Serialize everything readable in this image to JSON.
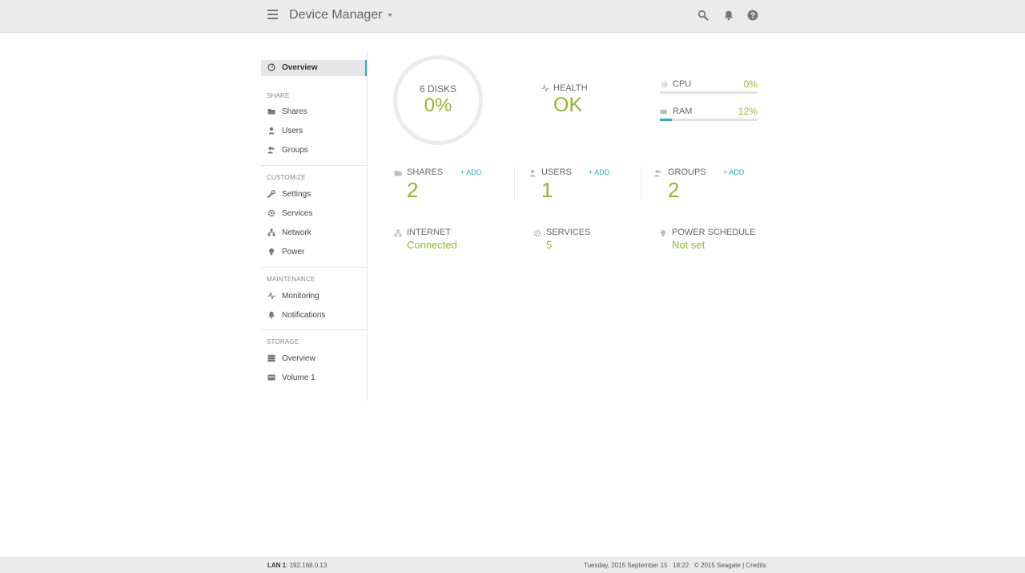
{
  "header": {
    "title": "Device Manager",
    "icons": [
      "search-icon",
      "bell-icon",
      "help-icon"
    ]
  },
  "sidebar": {
    "overview": "Overview",
    "sections": {
      "share": {
        "label": "SHARE",
        "items": [
          {
            "label": "Shares",
            "icon": "folder-icon"
          },
          {
            "label": "Users",
            "icon": "user-icon"
          },
          {
            "label": "Groups",
            "icon": "group-icon"
          }
        ]
      },
      "customize": {
        "label": "CUSTOMIZE",
        "items": [
          {
            "label": "Settings",
            "icon": "wrench-icon"
          },
          {
            "label": "Services",
            "icon": "gear-icon"
          },
          {
            "label": "Network",
            "icon": "network-icon"
          },
          {
            "label": "Power",
            "icon": "bulb-icon"
          }
        ]
      },
      "maintenance": {
        "label": "MAINTENANCE",
        "items": [
          {
            "label": "Monitoring",
            "icon": "pulse-icon"
          },
          {
            "label": "Notifications",
            "icon": "bell-icon"
          }
        ]
      },
      "storage": {
        "label": "STORAGE",
        "items": [
          {
            "label": "Overview",
            "icon": "storage-icon"
          },
          {
            "label": "Volume 1",
            "icon": "volume-icon"
          }
        ]
      }
    }
  },
  "overview": {
    "disks": {
      "label": "6 DISKS",
      "value": "0%"
    },
    "health": {
      "label": "HEALTH",
      "value": "OK"
    },
    "cpu": {
      "label": "CPU",
      "value": "0%",
      "fraction": 0.0
    },
    "ram": {
      "label": "RAM",
      "value": "12%",
      "fraction": 0.12
    },
    "stats": {
      "shares": {
        "label": "SHARES",
        "add": "+ ADD",
        "count": "2"
      },
      "users": {
        "label": "USERS",
        "add": "+ ADD",
        "count": "1"
      },
      "groups": {
        "label": "GROUPS",
        "add": "+ ADD",
        "count": "2"
      }
    },
    "info": {
      "internet": {
        "label": "INTERNET",
        "value": "Connected"
      },
      "services": {
        "label": "SERVICES",
        "value": "5"
      },
      "power": {
        "label": "POWER SCHEDULE",
        "value": "Not set"
      }
    }
  },
  "footer": {
    "lan_label": "LAN 1",
    "lan_ip": ": 192.168.0.13",
    "datetime": "Tuesday, 2015 September 15   18:22",
    "copyright": "© 2015 Seagate",
    "separator": "|",
    "credits": "Credits"
  },
  "colors": {
    "accent_green": "#8dbb2b",
    "accent_blue": "#2da8d8"
  }
}
